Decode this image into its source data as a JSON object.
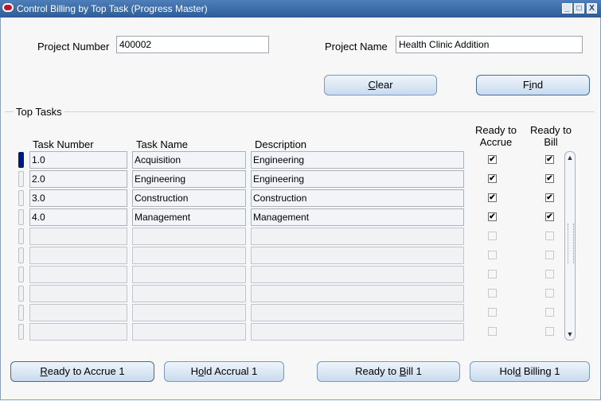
{
  "window": {
    "title": "Control Billing by Top Task (Progress Master)",
    "minimize_glyph": "_",
    "maximize_glyph": "□",
    "close_glyph": "X"
  },
  "header": {
    "project_number_label": "Project Number",
    "project_number_value": "400002",
    "project_name_label": "Project Name",
    "project_name_value": "Health Clinic Addition"
  },
  "actions": {
    "clear_pre": "",
    "clear_accel": "C",
    "clear_post": "lear",
    "find_pre": "F",
    "find_accel": "i",
    "find_post": "nd"
  },
  "top_tasks": {
    "section_label": "Top Tasks",
    "columns": {
      "task_number": "Task Number",
      "task_name": "Task Name",
      "description": "Description",
      "ready_to_accrue_line1": "Ready to",
      "ready_to_accrue_line2": "Accrue",
      "ready_to_bill_line1": "Ready to",
      "ready_to_bill_line2": "Bill"
    },
    "rows": [
      {
        "task_number": "1.0",
        "task_name": "Acquisition",
        "description": "Engineering",
        "accrue": true,
        "bill": true
      },
      {
        "task_number": "2.0",
        "task_name": "Engineering",
        "description": "Engineering",
        "accrue": true,
        "bill": true
      },
      {
        "task_number": "3.0",
        "task_name": "Construction",
        "description": "Construction",
        "accrue": true,
        "bill": true
      },
      {
        "task_number": "4.0",
        "task_name": "Management",
        "description": "Management",
        "accrue": true,
        "bill": true
      },
      {
        "task_number": "",
        "task_name": "",
        "description": "",
        "accrue": false,
        "bill": false
      },
      {
        "task_number": "",
        "task_name": "",
        "description": "",
        "accrue": false,
        "bill": false
      },
      {
        "task_number": "",
        "task_name": "",
        "description": "",
        "accrue": false,
        "bill": false
      },
      {
        "task_number": "",
        "task_name": "",
        "description": "",
        "accrue": false,
        "bill": false
      },
      {
        "task_number": "",
        "task_name": "",
        "description": "",
        "accrue": false,
        "bill": false
      },
      {
        "task_number": "",
        "task_name": "",
        "description": "",
        "accrue": false,
        "bill": false
      }
    ],
    "check_glyph": "✔"
  },
  "footer": {
    "ready_to_accrue_pre": "",
    "ready_to_accrue_accel": "R",
    "ready_to_accrue_post": "eady to Accrue 1",
    "hold_accrual_pre": "H",
    "hold_accrual_accel": "o",
    "hold_accrual_post": "ld Accrual 1",
    "ready_to_bill_pre": "Ready to ",
    "ready_to_bill_accel": "B",
    "ready_to_bill_post": "ill 1",
    "hold_billing_pre": "Hol",
    "hold_billing_accel": "d",
    "hold_billing_post": " Billing 1"
  },
  "scrollbar": {
    "up_glyph": "▲",
    "down_glyph": "▼"
  }
}
